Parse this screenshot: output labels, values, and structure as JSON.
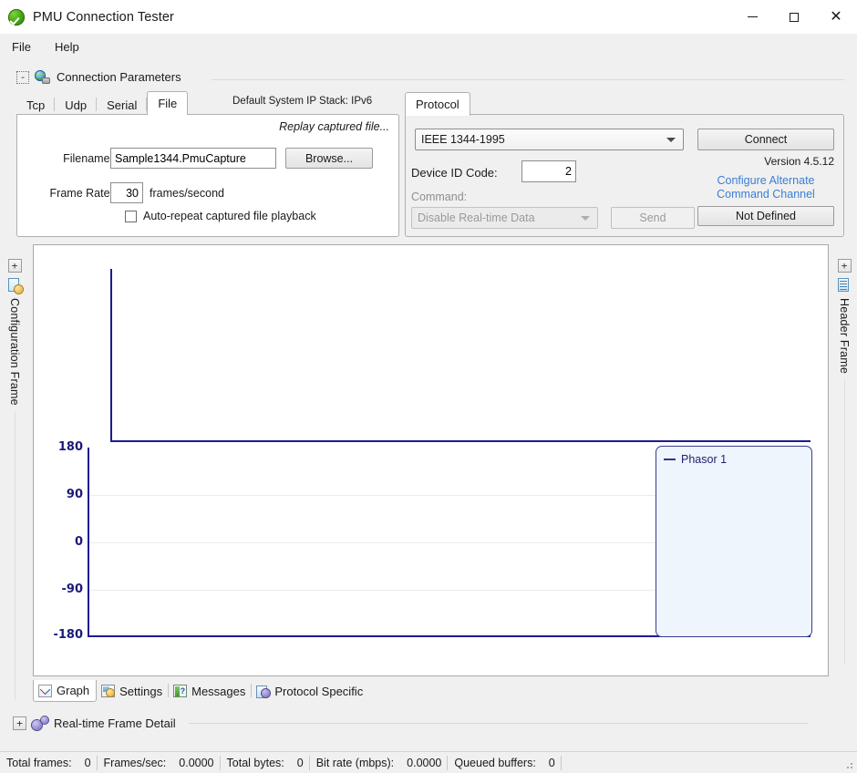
{
  "window": {
    "title": "PMU Connection Tester",
    "app_icon": "green-check-circle-icon",
    "minimize_label": "Minimize",
    "maximize_label": "Maximize",
    "close_label": "Close"
  },
  "menu": {
    "items": [
      {
        "label": "File",
        "name": "menu-file"
      },
      {
        "label": "Help",
        "name": "menu-help"
      }
    ]
  },
  "connection_parameters": {
    "group_title": "Connection Parameters",
    "expander": "-",
    "icon": "network-globe-icon",
    "ip_stack_text": "Default System IP Stack: IPv6",
    "tabs": [
      {
        "label": "Tcp",
        "active": false
      },
      {
        "label": "Udp",
        "active": false
      },
      {
        "label": "Serial",
        "active": false
      },
      {
        "label": "File",
        "active": true
      }
    ],
    "file_tab": {
      "replay_label": "Replay captured file...",
      "filename_label": "Filename:",
      "filename_value": "Sample1344.PmuCapture",
      "filename_placeholder": "",
      "browse_label": "Browse...",
      "frame_rate_label": "Frame Rate:",
      "frame_rate_value": "30",
      "frame_rate_units": "frames/second",
      "auto_repeat_label": "Auto-repeat captured file playback",
      "auto_repeat_checked": false
    }
  },
  "protocol": {
    "tab_label": "Protocol",
    "protocol_value": "IEEE 1344-1995",
    "device_id_label": "Device ID Code:",
    "device_id_value": "2",
    "command_label": "Command:",
    "command_value": "Disable Real-time Data",
    "send_label": "Send",
    "connect_label": "Connect",
    "version_text": "Version 4.5.12",
    "alt_channel_link_line1": "Configure Alternate",
    "alt_channel_link_line2": "Command Channel",
    "alt_channel_button_label": "Not Defined",
    "link_color": "#3a7fd5"
  },
  "docks": {
    "left": {
      "expander": "+",
      "label": "Configuration Frame",
      "icon": "config-frame-icon"
    },
    "right": {
      "expander": "+",
      "label": "Header Frame",
      "icon": "header-frame-icon"
    }
  },
  "chart_data": [
    {
      "type": "line",
      "name": "magnitude-chart",
      "title": "",
      "xlabel": "",
      "ylabel": "",
      "series": [
        {
          "name": "Phasor 1",
          "values": []
        }
      ],
      "x": [],
      "grid": false,
      "axis_color": "#1c1c8f",
      "ytick_labels": [],
      "legend": "none"
    },
    {
      "type": "line",
      "name": "angle-chart",
      "title": "",
      "xlabel": "",
      "ylabel": "",
      "series": [
        {
          "name": "Phasor 1",
          "values": []
        }
      ],
      "x": [],
      "ylim": [
        -180,
        180
      ],
      "yticks": [
        180,
        90,
        0,
        -90,
        -180
      ],
      "ytick_labels": [
        "180",
        "90",
        "0",
        "-90",
        "-180"
      ],
      "grid": true,
      "gridlines_at": [
        90,
        0,
        -90
      ],
      "axis_color": "#1c1c8f",
      "tick_color": "#1a1a7a",
      "legend": {
        "position": "right",
        "entries": [
          "Phasor 1"
        ],
        "bg": "#eef5fd",
        "border": "#3b3b8f"
      }
    }
  ],
  "bottom_tabs": [
    {
      "label": "Graph",
      "icon": "chart-icon",
      "active": true
    },
    {
      "label": "Settings",
      "icon": "settings-icon",
      "active": false
    },
    {
      "label": "Messages",
      "icon": "messages-icon",
      "active": false
    },
    {
      "label": "Protocol Specific",
      "icon": "protocol-icon",
      "active": false
    }
  ],
  "frame_detail": {
    "expander": "+",
    "icon": "gears-icon",
    "label": "Real-time Frame Detail"
  },
  "statusbar": {
    "cells": [
      {
        "label": "Total frames:",
        "value": "0"
      },
      {
        "label": "Frames/sec:",
        "value": "0.0000"
      },
      {
        "label": "Total bytes:",
        "value": "0"
      },
      {
        "label": "Bit rate (mbps):",
        "value": "0.0000"
      },
      {
        "label": "Queued buffers:",
        "value": "0"
      }
    ]
  }
}
